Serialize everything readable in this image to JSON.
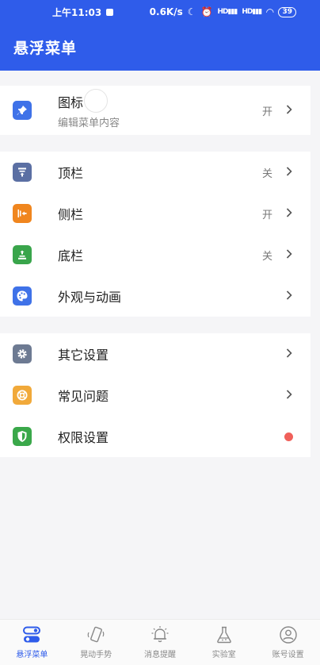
{
  "status_bar": {
    "time": "上午11:03",
    "speed": "0.6K/s",
    "signal1": "HD",
    "signal2": "HD",
    "battery": "39"
  },
  "app_bar": {
    "title": "悬浮菜单"
  },
  "colors": {
    "primary": "#2f5cea",
    "icon_pin": "#3f72e8",
    "icon_top": "#5b6fa3",
    "icon_side": "#f0861e",
    "icon_bottom": "#39a54b",
    "icon_appearance": "#3f72e8",
    "icon_other": "#6d7a92",
    "icon_faq": "#f1a93a",
    "icon_permission": "#3aa84a",
    "badge_dot": "#f0605a"
  },
  "section1": {
    "icon": {
      "title": "图标",
      "subtitle": "编辑菜单内容",
      "status": "开"
    }
  },
  "section2": {
    "top_bar": {
      "label": "顶栏",
      "status": "关"
    },
    "side_bar": {
      "label": "侧栏",
      "status": "开"
    },
    "bottom_bar": {
      "label": "底栏",
      "status": "关"
    },
    "appearance": {
      "label": "外观与动画"
    }
  },
  "section3": {
    "other": {
      "label": "其它设置"
    },
    "faq": {
      "label": "常见问题"
    },
    "permission": {
      "label": "权限设置"
    }
  },
  "bottom_nav": [
    {
      "label": "悬浮菜单",
      "icon": "toggle-icon",
      "active": true
    },
    {
      "label": "晃动手势",
      "icon": "shake-phone-icon",
      "active": false
    },
    {
      "label": "消息提醒",
      "icon": "bell-icon",
      "active": false
    },
    {
      "label": "实验室",
      "icon": "flask-icon",
      "active": false
    },
    {
      "label": "账号设置",
      "icon": "account-icon",
      "active": false
    }
  ]
}
